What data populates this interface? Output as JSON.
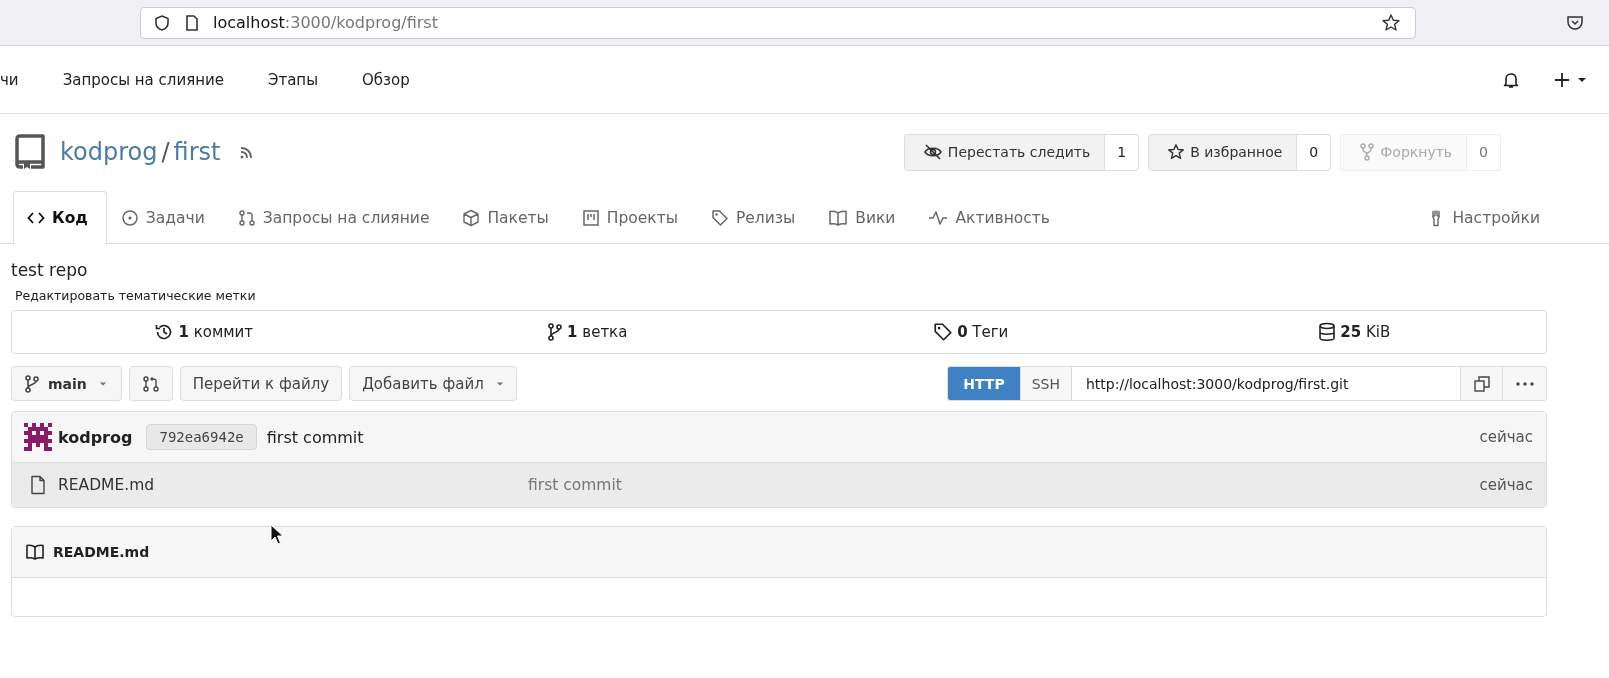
{
  "browser": {
    "url_host": "localhost",
    "url_path": ":3000/kodprog/first"
  },
  "navbar": {
    "items": [
      {
        "label": "чи"
      },
      {
        "label": "Запросы на слияние"
      },
      {
        "label": "Этапы"
      },
      {
        "label": "Обзор"
      }
    ]
  },
  "repo": {
    "owner": "kodprog",
    "separator": "/",
    "name": "first",
    "actions": [
      {
        "kind": "watch",
        "label": "Перестать следить",
        "count": "1",
        "disabled": false
      },
      {
        "kind": "star",
        "label": "В избранное",
        "count": "0",
        "disabled": false
      },
      {
        "kind": "fork",
        "label": "Форкнуть",
        "count": "0",
        "disabled": true
      }
    ]
  },
  "tabs": [
    {
      "kind": "code",
      "label": "Код",
      "selected": true
    },
    {
      "kind": "issues",
      "label": "Задачи",
      "selected": false
    },
    {
      "kind": "pulls",
      "label": "Запросы на слияние",
      "selected": false
    },
    {
      "kind": "packages",
      "label": "Пакеты",
      "selected": false
    },
    {
      "kind": "projects",
      "label": "Проекты",
      "selected": false
    },
    {
      "kind": "releases",
      "label": "Релизы",
      "selected": false
    },
    {
      "kind": "wiki",
      "label": "Вики",
      "selected": false
    },
    {
      "kind": "activity",
      "label": "Активность",
      "selected": false
    },
    {
      "kind": "settings",
      "label": "Настройки",
      "selected": false
    }
  ],
  "description": "test repo",
  "topics_link": "Редактировать тематические метки",
  "stats": [
    {
      "kind": "commits",
      "text": "**1** коммит"
    },
    {
      "kind": "branches",
      "text": "**1** ветка"
    },
    {
      "kind": "tags",
      "text": "**0** Теги"
    },
    {
      "kind": "size",
      "text": "**25** KiB"
    }
  ],
  "toolbar": {
    "branch": "main",
    "go_to_file": "Перейти к файлу",
    "add_file": "Добавить файл",
    "clone_protocols": [
      {
        "label": "HTTP",
        "selected": true
      },
      {
        "label": "SSH",
        "selected": false
      }
    ],
    "clone_url": "http://localhost:3000/kodprog/first.git"
  },
  "latest_commit": {
    "author": "kodprog",
    "sha": "792ea6942e",
    "message": "first commit",
    "time": "сейчас"
  },
  "files": [
    {
      "name": "README.md",
      "message": "first commit",
      "time": "сейчас"
    }
  ],
  "readme": {
    "title": "README.md"
  }
}
